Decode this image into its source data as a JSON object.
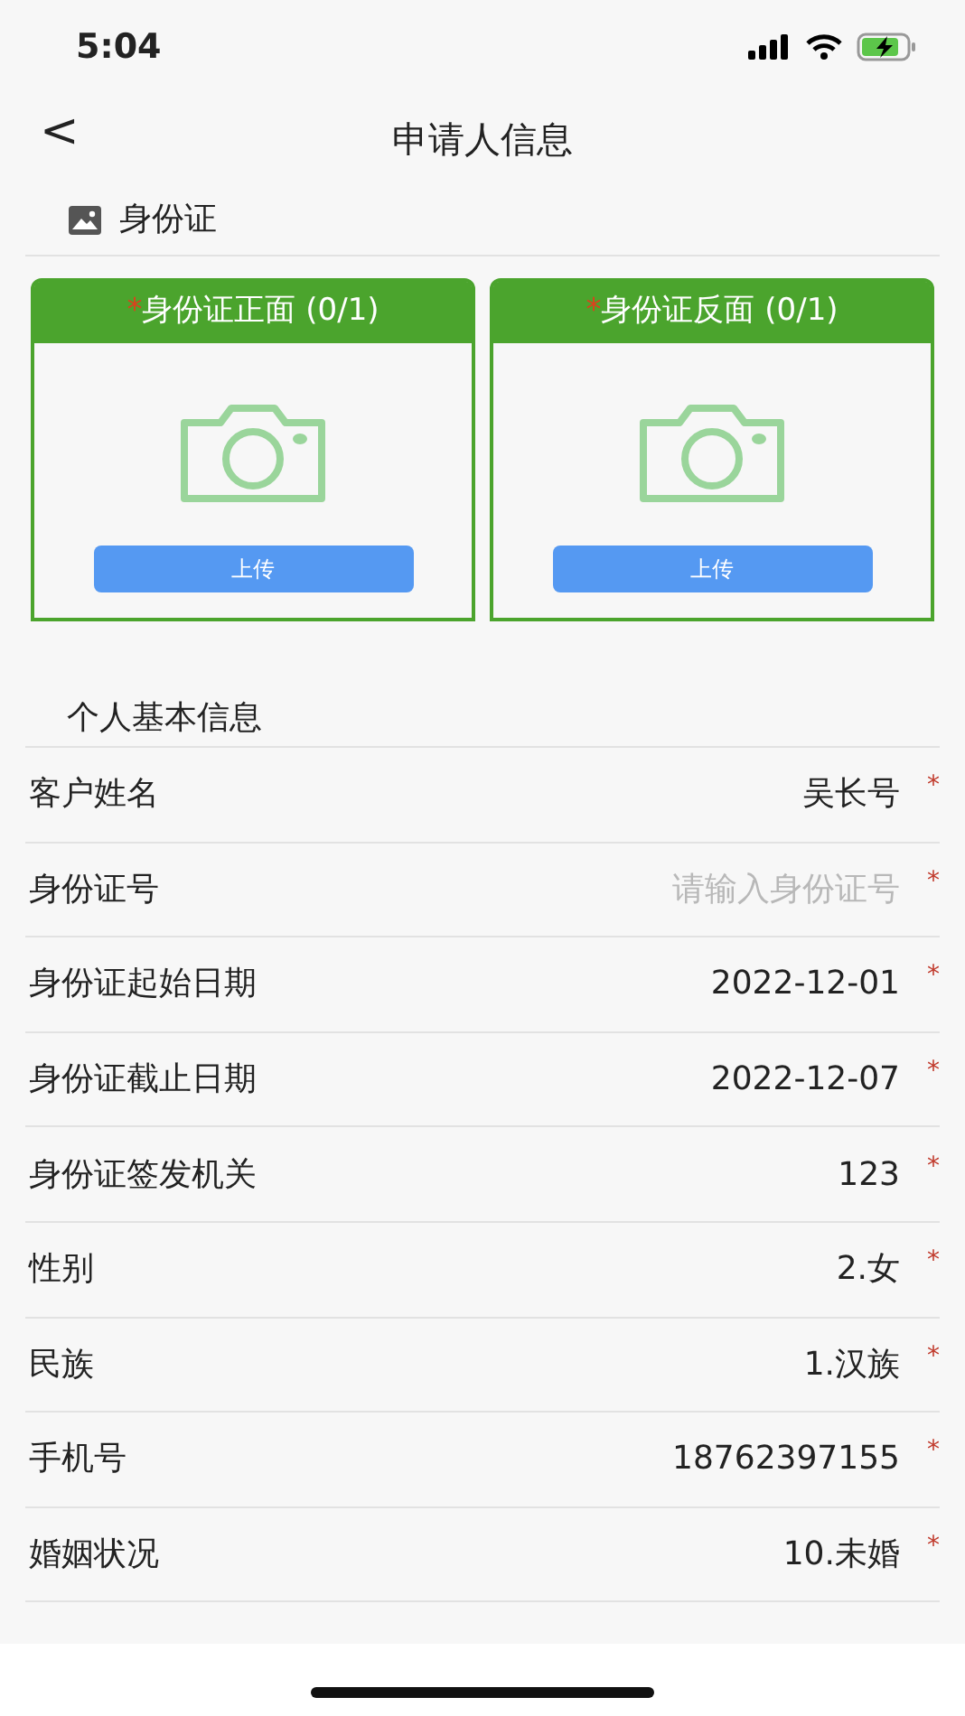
{
  "status_bar": {
    "time": "5:04"
  },
  "nav": {
    "back": "<",
    "title": "申请人信息"
  },
  "id_section": {
    "title": "身份证",
    "uploads": [
      {
        "mark": "*",
        "label": "身份证正面 (0/1)",
        "button": "上传"
      },
      {
        "mark": "*",
        "label": "身份证反面 (0/1)",
        "button": "上传"
      }
    ]
  },
  "basic_section": {
    "title": "个人基本信息",
    "fields": [
      {
        "label": "客户姓名",
        "value": "吴长号",
        "mark": "*"
      },
      {
        "label": "身份证号",
        "placeholder": "请输入身份证号",
        "mark": "*"
      },
      {
        "label": "身份证起始日期",
        "value": "2022-12-01",
        "mark": "*"
      },
      {
        "label": "身份证截止日期",
        "value": "2022-12-07",
        "mark": "*"
      },
      {
        "label": "身份证签发机关",
        "value": "123",
        "mark": "*"
      },
      {
        "label": "性别",
        "value": "2.女",
        "mark": "*"
      },
      {
        "label": "民族",
        "value": "1.汉族",
        "mark": "*"
      },
      {
        "label": "手机号",
        "value": "18762397155",
        "mark": "*"
      },
      {
        "label": "婚姻状况",
        "value": "10.未婚",
        "mark": "*"
      }
    ]
  }
}
